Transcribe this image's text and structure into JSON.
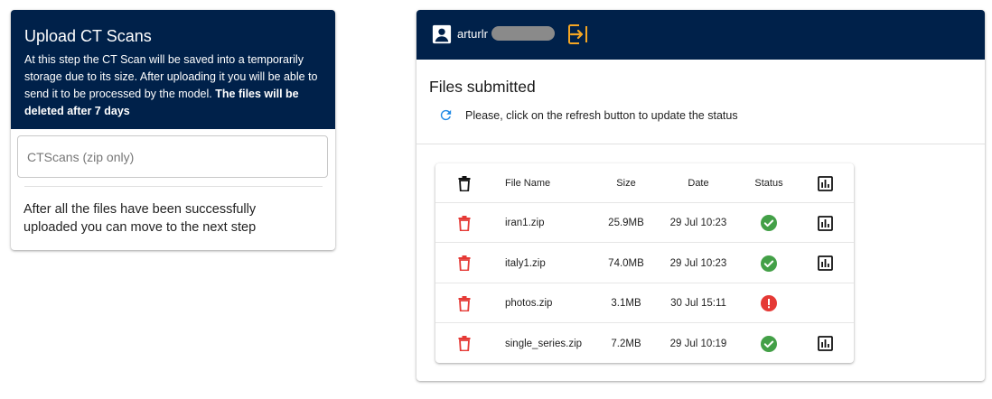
{
  "upload": {
    "title": "Upload CT Scans",
    "description": "At this step the CT Scan will be saved into a temporarily storage due to its size. After uploading it you will be able to send it to be processed by the model.",
    "description_bold": "The files will be deleted after 7 days",
    "file_input_placeholder": "CTScans (zip only)",
    "note": "After all the files have been successfully uploaded you can move to the next step"
  },
  "files": {
    "user": {
      "name_visible": "arturlr",
      "avatar_icon": "account-box-icon",
      "logout_icon": "logout-icon"
    },
    "title": "Files submitted",
    "refresh_text": "Please, click on the refresh button to update the status",
    "columns": {
      "delete_icon": "trash-icon",
      "name": "File Name",
      "size": "Size",
      "date": "Date",
      "status": "Status",
      "chart_icon": "bar-chart-icon"
    },
    "rows": [
      {
        "name": "iran1.zip",
        "size": "25.9MB",
        "date": "29 Jul 10:23",
        "status": "success",
        "has_chart": true
      },
      {
        "name": "italy1.zip",
        "size": "74.0MB",
        "date": "29 Jul 10:23",
        "status": "success",
        "has_chart": true
      },
      {
        "name": "photos.zip",
        "size": "3.1MB",
        "date": "30 Jul 15:11",
        "status": "error",
        "has_chart": false
      },
      {
        "name": "single_series.zip",
        "size": "7.2MB",
        "date": "29 Jul 10:19",
        "status": "success",
        "has_chart": true
      }
    ]
  },
  "colors": {
    "header_bg": "#00214a",
    "accent_orange": "#f5a623",
    "refresh_blue": "#1e88e5",
    "delete_red": "#e53935",
    "success_green": "#43a047",
    "error_red": "#e53935"
  }
}
